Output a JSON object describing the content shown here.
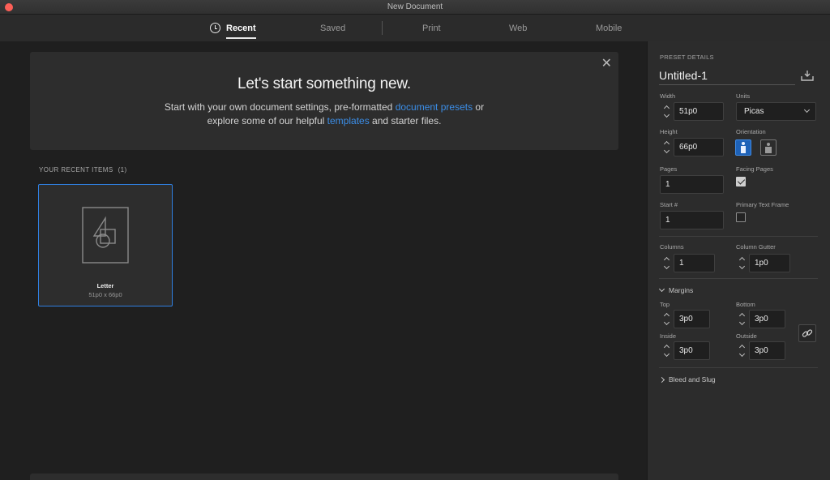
{
  "window": {
    "title": "New Document"
  },
  "tabs": [
    {
      "label": "Recent",
      "active": true
    },
    {
      "label": "Saved"
    },
    {
      "label": "Print"
    },
    {
      "label": "Web"
    },
    {
      "label": "Mobile"
    }
  ],
  "welcome": {
    "close_icon": "close-icon",
    "heading": "Let's start something new.",
    "line1_before": "Start with your own document settings, pre-formatted ",
    "line1_link": "document presets",
    "line1_after": " or",
    "line2_before": "explore some of our helpful ",
    "line2_link": "templates",
    "line2_after": " and starter files."
  },
  "recent": {
    "heading": "YOUR RECENT ITEMS",
    "count": "(1)",
    "items": [
      {
        "name": "Letter",
        "size": "51p0 x 66p0"
      }
    ]
  },
  "preset": {
    "section_label": "PRESET DETAILS",
    "name": "Untitled-1",
    "width_label": "Width",
    "width": "51p0",
    "units_label": "Units",
    "units": "Picas",
    "height_label": "Height",
    "height": "66p0",
    "orientation_label": "Orientation",
    "orientation": "portrait",
    "pages_label": "Pages",
    "pages": "1",
    "facing_pages_label": "Facing Pages",
    "facing_pages": true,
    "start_label": "Start #",
    "start": "1",
    "primary_text_frame_label": "Primary Text Frame",
    "primary_text_frame": false,
    "columns_label": "Columns",
    "columns": "1",
    "column_gutter_label": "Column Gutter",
    "column_gutter": "1p0",
    "margins_label": "Margins",
    "margin_top_label": "Top",
    "margin_top": "3p0",
    "margin_bottom_label": "Bottom",
    "margin_bottom": "3p0",
    "margin_inside_label": "Inside",
    "margin_inside": "3p0",
    "margin_outside_label": "Outside",
    "margin_outside": "3p0",
    "bleed_label": "Bleed and Slug"
  },
  "colors": {
    "accent": "#2f7fe0",
    "link": "#3b8ee8",
    "panel": "#2c2c2c",
    "background": "#1e1e1e"
  }
}
